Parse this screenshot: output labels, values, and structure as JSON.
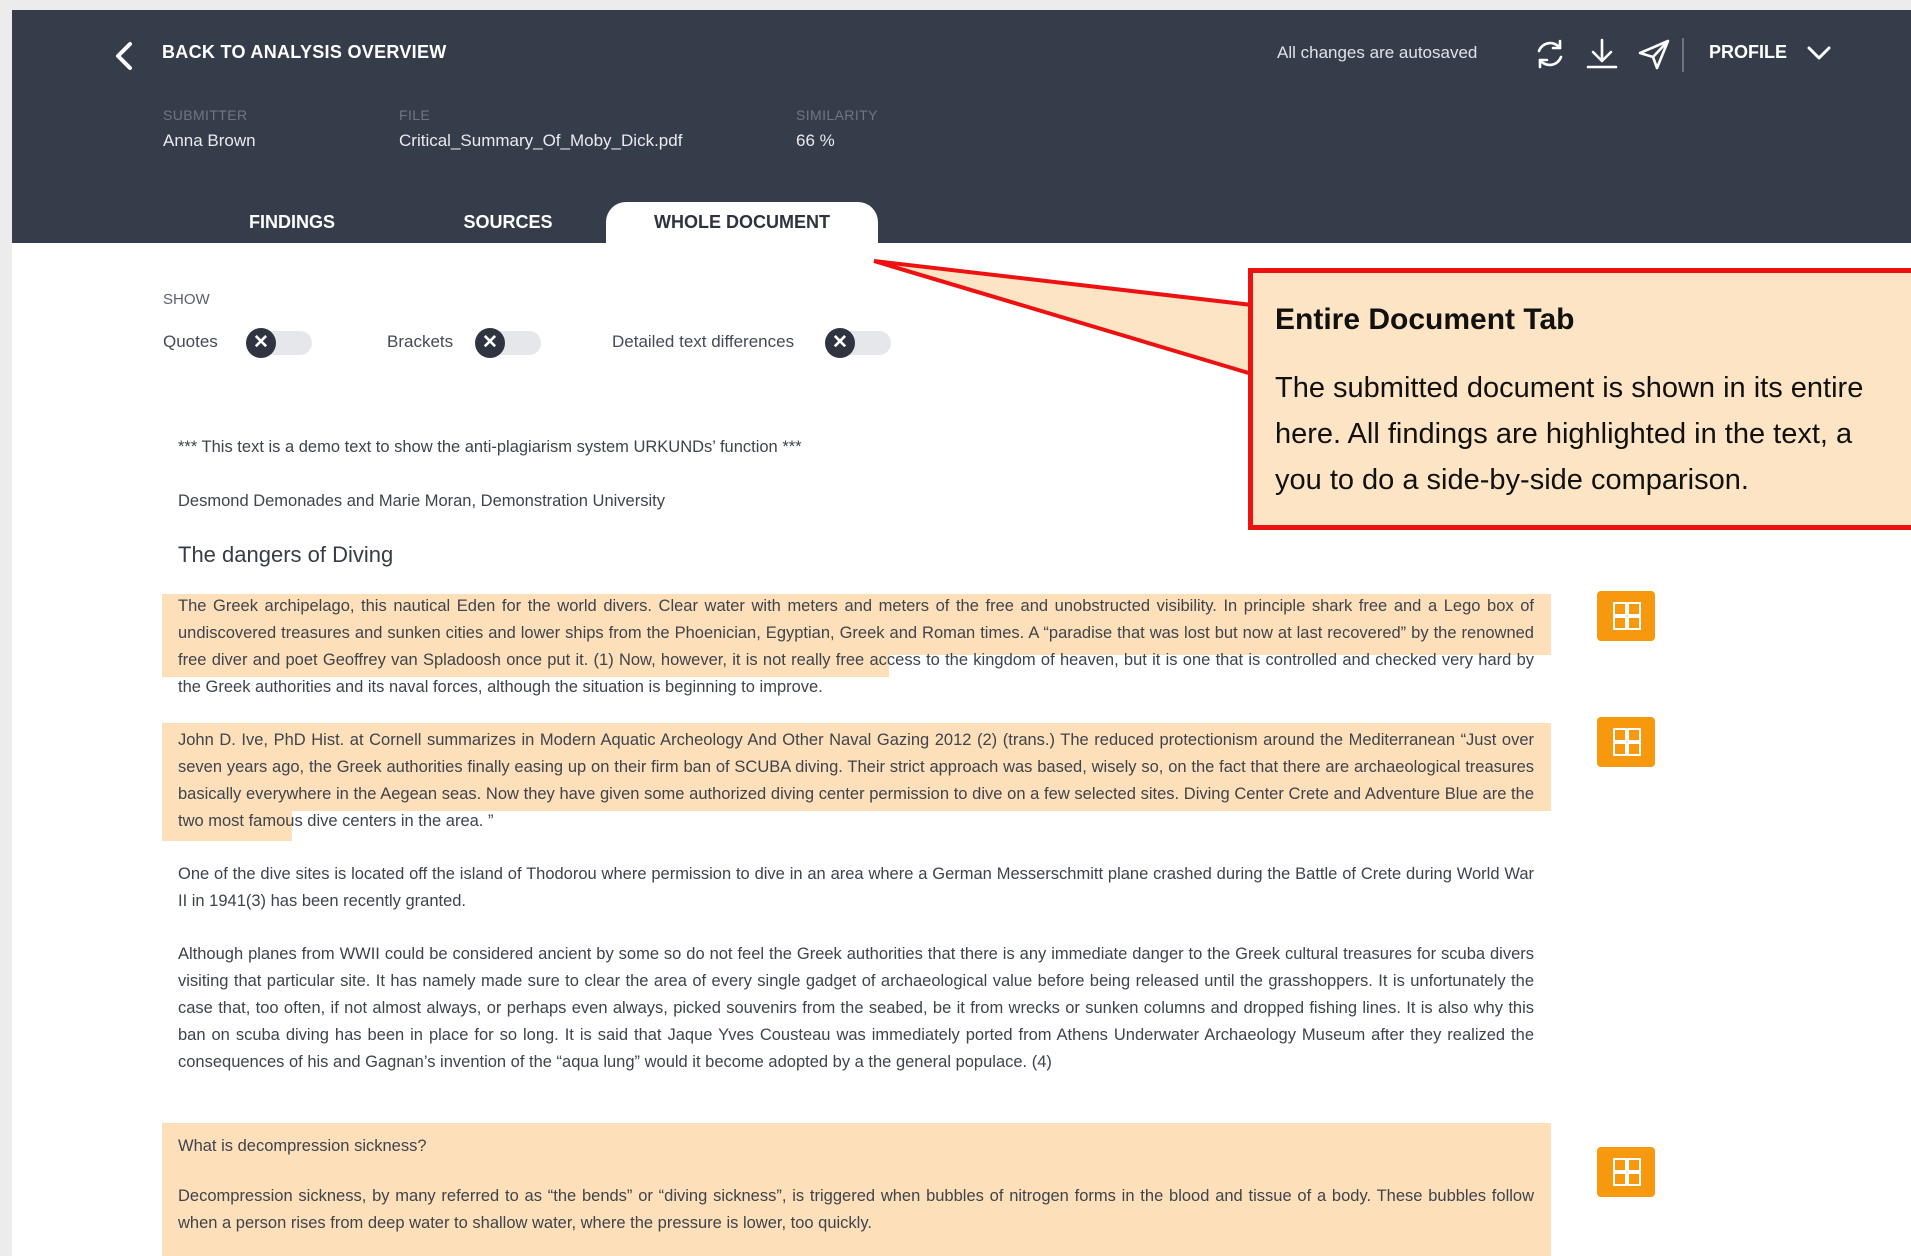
{
  "header": {
    "back_label": "BACK TO ANALYSIS OVERVIEW",
    "autosave_text": "All changes are autosaved",
    "profile_label": "PROFILE"
  },
  "meta": {
    "submitter_label": "SUBMITTER",
    "submitter_value": "Anna Brown",
    "file_label": "FILE",
    "file_value": "Critical_Summary_Of_Moby_Dick.pdf",
    "similarity_label": "SIMILARITY",
    "similarity_value": "66 %"
  },
  "tabs": [
    {
      "label": "FINDINGS"
    },
    {
      "label": "SOURCES"
    },
    {
      "label": "WHOLE DOCUMENT",
      "active": true
    }
  ],
  "show": {
    "label": "SHOW",
    "toggles": [
      {
        "label": "Quotes",
        "state": "off"
      },
      {
        "label": "Brackets",
        "state": "off"
      },
      {
        "label": "Detailed text differences",
        "state": "off"
      }
    ]
  },
  "document": {
    "intro_line": "*** This text is a demo text to show the anti-plagiarism system URKUNDs’ function ***",
    "authors_line": "Desmond Demonades and Marie Moran, Demonstration University",
    "title": "The dangers of Diving",
    "p1": "The Greek archipelago, this nautical Eden for the world divers. Clear water with meters and meters of the free and unobstructed visibility. In principle shark free and a Lego box of undiscovered treasures and sunken cities and lower ships from the Phoenician, Egyptian, Greek and Roman times. A “paradise that was lost but now at last recovered” by the renowned free diver and poet Geoffrey van Spladoosh once put it. (1) Now, however, it is not really free access to the kingdom of heaven, but it is one that is controlled and checked very hard by the Greek authorities and its naval forces, although the situation is beginning to improve.",
    "p2": "John D. Ive, PhD Hist. at Cornell summarizes in Modern Aquatic Archeology And Other Naval Gazing 2012 (2) (trans.) The reduced protectionism around the Mediterranean “Just over seven years ago, the Greek authorities finally easing up on their firm ban of SCUBA diving. Their strict approach was based, wisely so, on the fact that there are archaeological treasures basically everywhere in the Aegean seas. Now they have given some authorized diving center permission to dive on a few selected sites. Diving Center Crete and Adventure Blue are the two most famous dive centers in the area. ”",
    "p3": "One of the dive sites is located off the island of Thodorou where permission to dive in an area where a German Messerschmitt plane crashed during the Battle of Crete during World War II in 1941(3) has been recently granted.",
    "p4": "Although planes from WWII could be considered ancient by some so do not feel the Greek authorities that there is any immediate danger to the Greek cultural treasures for scuba divers visiting that particular site. It has namely made sure to clear the area of every single gadget of archaeological value before being released until the grasshoppers. It is unfortunately the case that, too often, if not almost always, or perhaps even always, picked souvenirs from the seabed, be it from wrecks or sunken columns and dropped fishing lines. It is also why this ban on scuba diving has been in place for so long. It is said that Jaque Yves Cousteau was immediately ported from Athens Underwater Archaeology Museum after they realized the consequences of his and Gagnan’s invention of the “aqua lung” would it become adopted by a the general populace. (4)",
    "q1": "What is decompression sickness?",
    "p5": "Decompression sickness, by many referred to as “the bends” or “diving sickness”, is triggered when bubbles of nitrogen forms in the blood and tissue of a body. These bubbles follow when a person rises from deep water to shallow water, where the pressure is lower, too quickly."
  },
  "callout": {
    "title": "Entire Document Tab",
    "lines": [
      "The submitted document is shown in its entire",
      "here. All findings are highlighted in the text, a",
      "you to do a side-by-side comparison."
    ]
  },
  "colors": {
    "header_bg": "#363d4a",
    "highlight": "#fde0b9",
    "match_button": "#f6990f",
    "callout_border": "#ee1111",
    "callout_bg": "#fde4c4"
  }
}
